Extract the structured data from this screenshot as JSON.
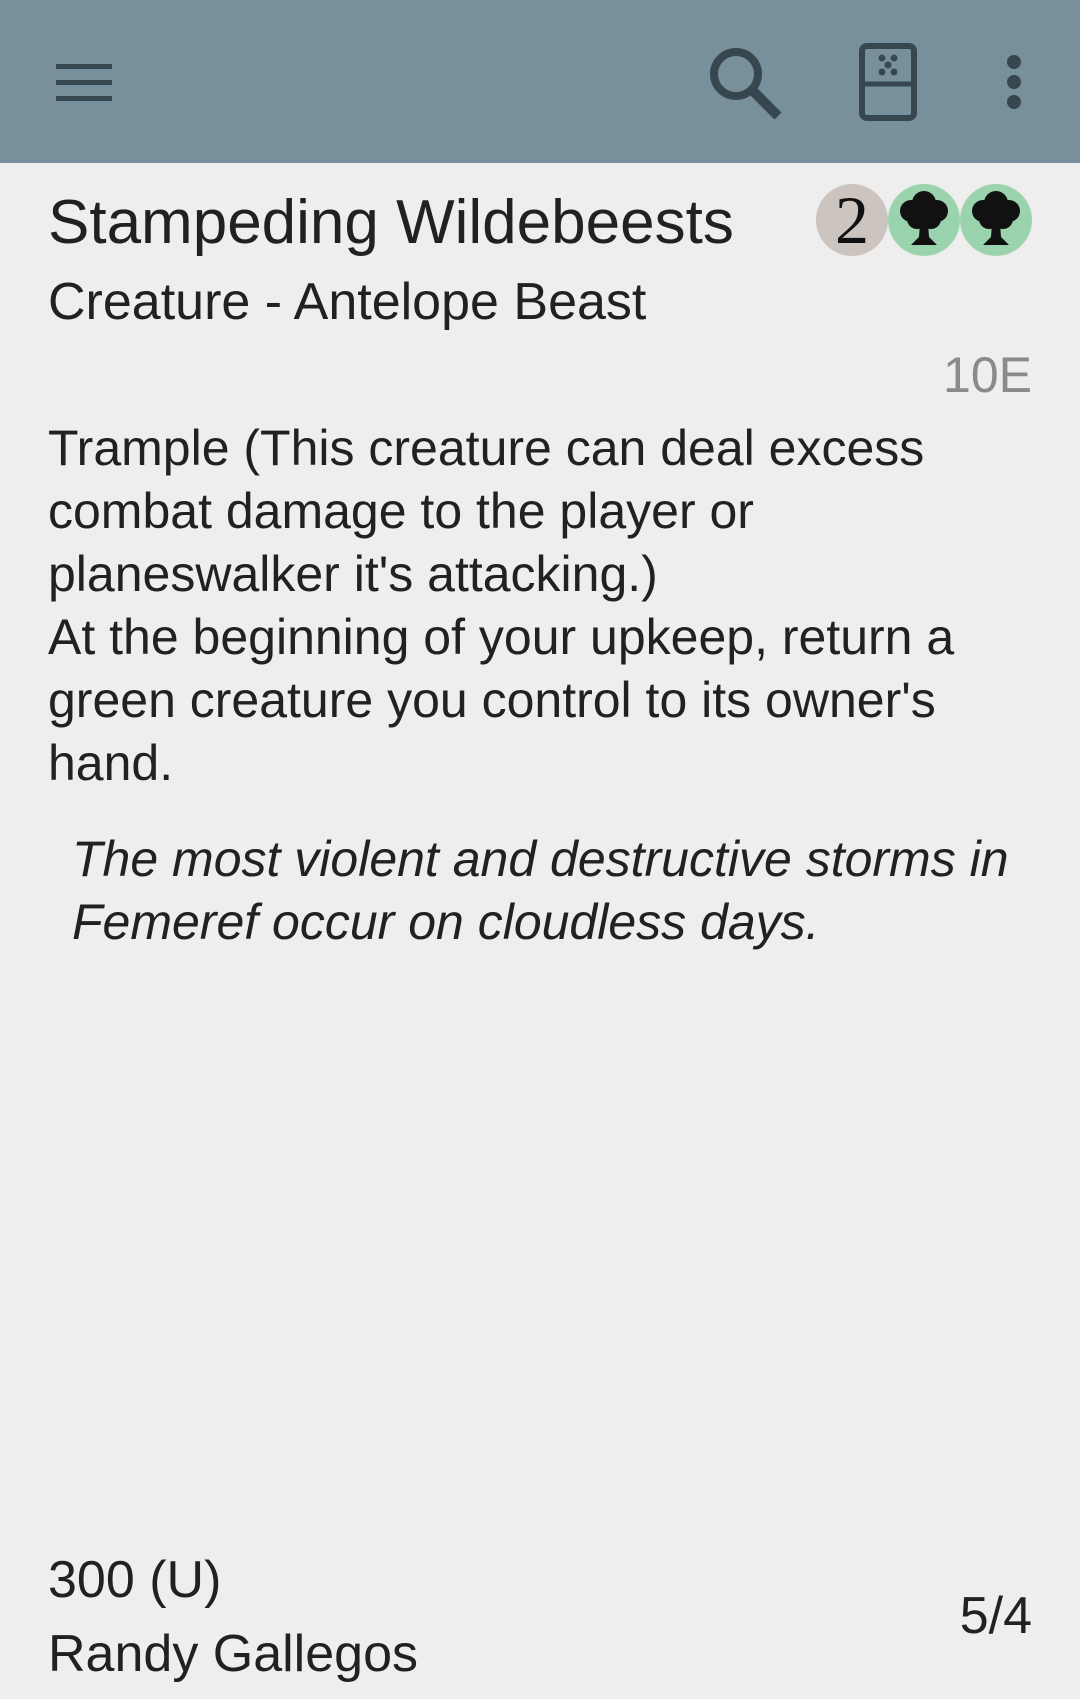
{
  "appbar": {
    "background": "#78909c",
    "icons": [
      "hamburger-menu-icon",
      "search-icon",
      "dice-icon",
      "more-vert-icon"
    ]
  },
  "card": {
    "name": "Stampeding Wildebeests",
    "type_line": "Creature - Antelope Beast",
    "set_code": "10E",
    "mana_cost": {
      "generic": "2",
      "colored": [
        "green",
        "green"
      ],
      "colors": {
        "generic": "#cbc4bf",
        "green": "#9bd3ae"
      }
    },
    "rules_text": [
      "Trample (This creature can deal excess combat damage to the player or planeswalker it's attacking.)",
      "At the beginning of your upkeep, return a green creature you control to its owner's hand."
    ],
    "flavor_text": "The most violent and destructive storms in Femeref occur on cloudless days.",
    "collector_info": "300 (U)",
    "artist": "Randy Gallegos",
    "power_toughness": "5/4"
  }
}
